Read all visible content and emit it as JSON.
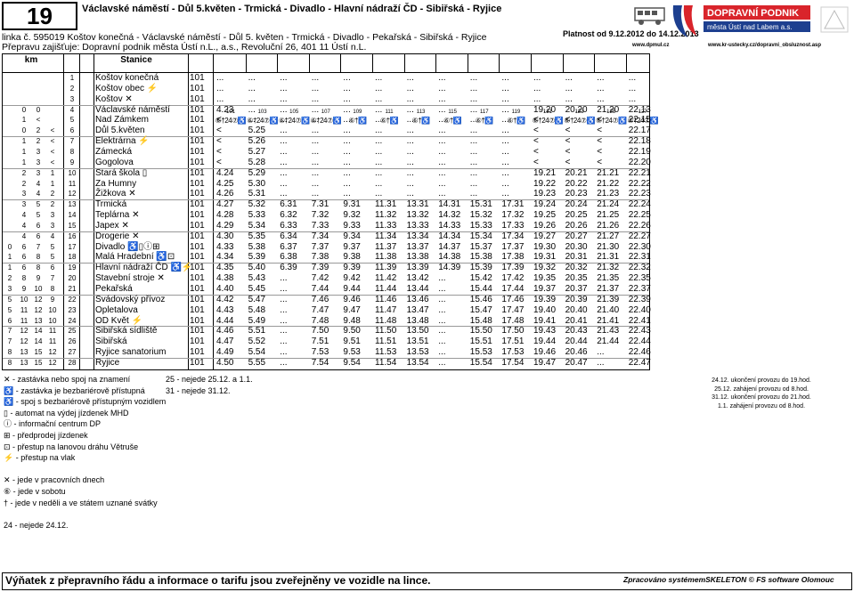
{
  "header": {
    "line_number": "19",
    "route": "Václavské náměstí - Důl 5.květen - Trmická - Divadlo - Hlavní nádraží ČD - Sibiřská - Ryjice",
    "line_info": "linka č. 595019 Koštov konečná - Václavské náměstí - Důl 5. květen - Trmická - Divadlo - Pekařská - Sibiřská - Ryjice",
    "provider": "Přepravu zajišťuje: Dopravní podnik města Ústí n.L., a.s., Revoluční 26, 401 11 Ústí n.L.",
    "validity": "Platnost od 9.12.2012 do 14.12.2013",
    "url_dpmul": "www.dpmul.cz",
    "url_kr": "www.kr-ustecky.cz/dopravni_obsluznost.asp",
    "logo_name": "DOPRAVNÍ PODNIK",
    "logo_sub": "města Ústí nad Labem a.s."
  },
  "table": {
    "km_header": "km",
    "station_header": "Stanice",
    "trips": [
      {
        "num": "101",
        "flags": "⑥†24⑦♿"
      },
      {
        "num": "103",
        "flags": "⑥†24⑦♿"
      },
      {
        "num": "105",
        "flags": "⑥†24⑦♿"
      },
      {
        "num": "107",
        "flags": "⑥†24⑦♿"
      },
      {
        "num": "109",
        "flags": "⑥†♿"
      },
      {
        "num": "111",
        "flags": "⑥†♿"
      },
      {
        "num": "113",
        "flags": "⑥†♿"
      },
      {
        "num": "115",
        "flags": "⑥†♿"
      },
      {
        "num": "117",
        "flags": "⑥†♿"
      },
      {
        "num": "119",
        "flags": "⑥†♿"
      },
      {
        "num": "121",
        "flags": "⑥†24⑦♿"
      },
      {
        "num": "123",
        "flags": "⑥†24⑦♿"
      },
      {
        "num": "125",
        "flags": "⑥†24⑦♿"
      },
      {
        "num": "127",
        "flags": "⑥†24⑦♿"
      }
    ],
    "rows": [
      {
        "k1": "",
        "k2": "",
        "k3": "",
        "no": "1",
        "name": "Koštov konečná",
        "zone": "101",
        "times": [
          "...",
          "...",
          "...",
          "...",
          "...",
          "...",
          "...",
          "...",
          "...",
          "...",
          "...",
          "...",
          "...",
          "..."
        ]
      },
      {
        "k1": "",
        "k2": "",
        "k3": "",
        "no": "2",
        "name": "Koštov obec ⚡",
        "zone": "101",
        "times": [
          "...",
          "...",
          "...",
          "...",
          "...",
          "...",
          "...",
          "...",
          "...",
          "...",
          "...",
          "...",
          "...",
          "..."
        ]
      },
      {
        "k1": "",
        "k2": "",
        "k3": "",
        "no": "3",
        "name": "Koštov ✕",
        "zone": "101",
        "times": [
          "...",
          "...",
          "...",
          "...",
          "...",
          "...",
          "...",
          "...",
          "...",
          "...",
          "...",
          "...",
          "...",
          "..."
        ]
      },
      {
        "k1": "0",
        "k2": "0",
        "k3": "",
        "no": "4",
        "name": "Václavské náměstí",
        "zone": "101",
        "times": [
          "4.23",
          "...",
          "...",
          "...",
          "...",
          "...",
          "...",
          "...",
          "...",
          "...",
          "19.20",
          "20.20",
          "21.20",
          "22.13"
        ]
      },
      {
        "k1": "1",
        "k2": "<",
        "k3": "",
        "no": "5",
        "name": "Nad Zámkem",
        "zone": "101",
        "times": [
          "<",
          "...",
          "...",
          "...",
          "...",
          "...",
          "...",
          "...",
          "...",
          "...",
          "<",
          "<",
          "<",
          "22.15"
        ]
      },
      {
        "k1": "0",
        "k2": "2",
        "k3": "<",
        "no": "6",
        "name": "Důl 5.květen",
        "zone": "101",
        "times": [
          "<",
          "5.25",
          "...",
          "...",
          "...",
          "...",
          "...",
          "...",
          "...",
          "...",
          "<",
          "<",
          "<",
          "22.17"
        ]
      },
      {
        "k1": "1",
        "k2": "2",
        "k3": "<",
        "no": "7",
        "name": "Elektrárna ⚡",
        "zone": "101",
        "times": [
          "<",
          "5.26",
          "...",
          "...",
          "...",
          "...",
          "...",
          "...",
          "...",
          "...",
          "<",
          "<",
          "<",
          "22.18"
        ]
      },
      {
        "k1": "1",
        "k2": "3",
        "k3": "<",
        "no": "8",
        "name": "Zámecká",
        "zone": "101",
        "times": [
          "<",
          "5.27",
          "...",
          "...",
          "...",
          "...",
          "...",
          "...",
          "...",
          "...",
          "<",
          "<",
          "<",
          "22.19"
        ]
      },
      {
        "k1": "1",
        "k2": "3",
        "k3": "<",
        "no": "9",
        "name": "Gogolova",
        "zone": "101",
        "times": [
          "<",
          "5.28",
          "...",
          "...",
          "...",
          "...",
          "...",
          "...",
          "...",
          "...",
          "<",
          "<",
          "<",
          "22.20"
        ]
      },
      {
        "k1": "2",
        "k2": "3",
        "k3": "1",
        "no": "10",
        "name": "Stará škola ▯",
        "zone": "101",
        "times": [
          "4.24",
          "5.29",
          "...",
          "...",
          "...",
          "...",
          "...",
          "...",
          "...",
          "...",
          "19.21",
          "20.21",
          "21.21",
          "22.21"
        ]
      },
      {
        "k1": "2",
        "k2": "4",
        "k3": "1",
        "no": "11",
        "name": "Za Humny",
        "zone": "101",
        "times": [
          "4.25",
          "5.30",
          "...",
          "...",
          "...",
          "...",
          "...",
          "...",
          "...",
          "...",
          "19.22",
          "20.22",
          "21.22",
          "22.22"
        ]
      },
      {
        "k1": "3",
        "k2": "4",
        "k3": "2",
        "no": "12",
        "name": "Žižkova ✕",
        "zone": "101",
        "times": [
          "4.26",
          "5.31",
          "...",
          "...",
          "...",
          "...",
          "...",
          "...",
          "...",
          "...",
          "19.23",
          "20.23",
          "21.23",
          "22.23"
        ]
      },
      {
        "k1": "3",
        "k2": "5",
        "k3": "2",
        "no": "13",
        "name": "Trmická",
        "zone": "101",
        "times": [
          "4.27",
          "5.32",
          "6.31",
          "7.31",
          "9.31",
          "11.31",
          "13.31",
          "14.31",
          "15.31",
          "17.31",
          "19.24",
          "20.24",
          "21.24",
          "22.24"
        ]
      },
      {
        "k1": "4",
        "k2": "5",
        "k3": "3",
        "no": "14",
        "name": "Teplárna ✕",
        "zone": "101",
        "times": [
          "4.28",
          "5.33",
          "6.32",
          "7.32",
          "9.32",
          "11.32",
          "13.32",
          "14.32",
          "15.32",
          "17.32",
          "19.25",
          "20.25",
          "21.25",
          "22.25"
        ]
      },
      {
        "k1": "4",
        "k2": "6",
        "k3": "3",
        "no": "15",
        "name": "Japex ✕",
        "zone": "101",
        "times": [
          "4.29",
          "5.34",
          "6.33",
          "7.33",
          "9.33",
          "11.33",
          "13.33",
          "14.33",
          "15.33",
          "17.33",
          "19.26",
          "20.26",
          "21.26",
          "22.26"
        ]
      },
      {
        "k1": "4",
        "k2": "6",
        "k3": "4",
        "no": "16",
        "name": "Drogerie ✕",
        "zone": "101",
        "times": [
          "4.30",
          "5.35",
          "6.34",
          "7.34",
          "9.34",
          "11.34",
          "13.34",
          "14.34",
          "15.34",
          "17.34",
          "19.27",
          "20.27",
          "21.27",
          "22.27"
        ]
      },
      {
        "k1": "0",
        "k2": "6",
        "k3": "7",
        "k4": "5",
        "no": "17",
        "name": "Divadlo ♿▯ⓘ⊞",
        "zone": "101",
        "times": [
          "4.33",
          "5.38",
          "6.37",
          "7.37",
          "9.37",
          "11.37",
          "13.37",
          "14.37",
          "15.37",
          "17.37",
          "19.30",
          "20.30",
          "21.30",
          "22.30"
        ]
      },
      {
        "k1": "1",
        "k2": "6",
        "k3": "8",
        "k4": "5",
        "no": "18",
        "name": "Malá Hradební ♿⊡",
        "zone": "101",
        "times": [
          "4.34",
          "5.39",
          "6.38",
          "7.38",
          "9.38",
          "11.38",
          "13.38",
          "14.38",
          "15.38",
          "17.38",
          "19.31",
          "20.31",
          "21.31",
          "22.31"
        ]
      },
      {
        "k1": "1",
        "k2": "6",
        "k3": "8",
        "k4": "6",
        "no": "19",
        "name": "Hlavní nádraží ČD ♿⚡",
        "zone": "101",
        "times": [
          "4.35",
          "5.40",
          "6.39",
          "7.39",
          "9.39",
          "11.39",
          "13.39",
          "14.39",
          "15.39",
          "17.39",
          "19.32",
          "20.32",
          "21.32",
          "22.32"
        ]
      },
      {
        "k1": "2",
        "k2": "8",
        "k3": "9",
        "k4": "7",
        "no": "20",
        "name": "Stavební stroje ✕",
        "zone": "101",
        "times": [
          "4.38",
          "5.43",
          "...",
          "7.42",
          "9.42",
          "11.42",
          "13.42",
          "...",
          "15.42",
          "17.42",
          "19.35",
          "20.35",
          "21.35",
          "22.35"
        ]
      },
      {
        "k1": "3",
        "k2": "9",
        "k3": "10",
        "k4": "8",
        "no": "21",
        "name": "Pekařská",
        "zone": "101",
        "times": [
          "4.40",
          "5.45",
          "...",
          "7.44",
          "9.44",
          "11.44",
          "13.44",
          "...",
          "15.44",
          "17.44",
          "19.37",
          "20.37",
          "21.37",
          "22.37"
        ]
      },
      {
        "k1": "5",
        "k2": "10",
        "k3": "12",
        "k4": "9",
        "no": "22",
        "name": "Svádovský přívoz",
        "zone": "101",
        "times": [
          "4.42",
          "5.47",
          "...",
          "7.46",
          "9.46",
          "11.46",
          "13.46",
          "...",
          "15.46",
          "17.46",
          "19.39",
          "20.39",
          "21.39",
          "22.39"
        ]
      },
      {
        "k1": "5",
        "k2": "11",
        "k3": "12",
        "k4": "10",
        "no": "23",
        "name": "Opletalova",
        "zone": "101",
        "times": [
          "4.43",
          "5.48",
          "...",
          "7.47",
          "9.47",
          "11.47",
          "13.47",
          "...",
          "15.47",
          "17.47",
          "19.40",
          "20.40",
          "21.40",
          "22.40"
        ]
      },
      {
        "k1": "6",
        "k2": "11",
        "k3": "13",
        "k4": "10",
        "no": "24",
        "name": "OD Květ ⚡",
        "zone": "101",
        "times": [
          "4.44",
          "5.49",
          "...",
          "7.48",
          "9.48",
          "11.48",
          "13.48",
          "...",
          "15.48",
          "17.48",
          "19.41",
          "20.41",
          "21.41",
          "22.41"
        ]
      },
      {
        "k1": "7",
        "k2": "12",
        "k3": "14",
        "k4": "11",
        "no": "25",
        "name": "Sibiřská sídliště",
        "zone": "101",
        "times": [
          "4.46",
          "5.51",
          "...",
          "7.50",
          "9.50",
          "11.50",
          "13.50",
          "...",
          "15.50",
          "17.50",
          "19.43",
          "20.43",
          "21.43",
          "22.43"
        ]
      },
      {
        "k1": "7",
        "k2": "12",
        "k3": "14",
        "k4": "11",
        "no": "26",
        "name": "Sibiřská",
        "zone": "101",
        "times": [
          "4.47",
          "5.52",
          "...",
          "7.51",
          "9.51",
          "11.51",
          "13.51",
          "...",
          "15.51",
          "17.51",
          "19.44",
          "20.44",
          "21.44",
          "22.44"
        ]
      },
      {
        "k1": "8",
        "k2": "13",
        "k3": "15",
        "k4": "12",
        "no": "27",
        "name": "Ryjice sanatorium",
        "zone": "101",
        "times": [
          "4.49",
          "5.54",
          "...",
          "7.53",
          "9.53",
          "11.53",
          "13.53",
          "...",
          "15.53",
          "17.53",
          "19.46",
          "20.46",
          "...",
          "22.46"
        ]
      },
      {
        "k1": "8",
        "k2": "13",
        "k3": "15",
        "k4": "12",
        "no": "28",
        "name": "Ryjice",
        "zone": "101",
        "times": [
          "4.50",
          "5.55",
          "...",
          "7.54",
          "9.54",
          "11.54",
          "13.54",
          "...",
          "15.54",
          "17.54",
          "19.47",
          "20.47",
          "...",
          "22.47"
        ]
      }
    ]
  },
  "legend_left": [
    "✕ - zastávka nebo spoj na znamení",
    "♿ - zastávka je bezbariérově přístupná",
    "♿ - spoj s bezbariérově přístupným vozidlem",
    "▯ - automat na výdej jízdenek MHD",
    "ⓘ - informační centrum DP",
    "⊞ - předprodej jízdenek",
    "⊡ - přestup na lanovou dráhu Větruše",
    "⚡ - přestup na vlak",
    "",
    "✕ - jede v pracovních dnech",
    "⑥ - jede v sobotu",
    "† - jede v neděli a ve státem uznané svátky",
    "",
    "24 - nejede 24.12."
  ],
  "legend_mid": [
    "25 - nejede 25.12. a 1.1.",
    "31 - nejede 31.12."
  ],
  "notes": [
    "24.12. ukončení provozu do 19.hod.",
    "25.12. zahájení provozu od 8.hod.",
    "31.12. ukončení provozu do 21.hod.",
    "1.1. zahájení provozu od 8.hod."
  ],
  "footer": {
    "left": "Výňatek z přepravního řádu a informace o tarifu jsou zveřejněny ve vozidle na lince.",
    "right": "Zpracováno systémemSKELETON © FS software Olomouc"
  },
  "colors": {
    "logo_red": "#d9242b",
    "logo_blue": "#1d3f8f"
  }
}
